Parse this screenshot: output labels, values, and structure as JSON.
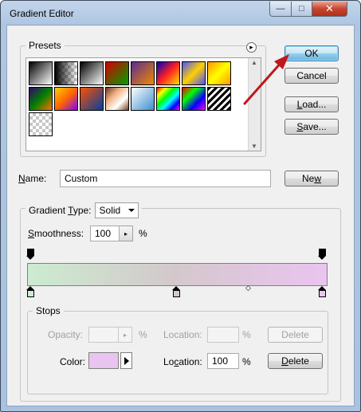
{
  "window": {
    "title": "Gradient Editor",
    "min_glyph": "—",
    "max_glyph": "□",
    "close_glyph": "✕"
  },
  "presets": {
    "label": "Presets",
    "menu_glyph": "▸",
    "scroll_up": "▲",
    "scroll_down": "▼",
    "swatches": [
      [
        "#000000",
        "#ffffff"
      ],
      [
        "#000000",
        "transparent"
      ],
      [
        "#000000",
        "#ffffff"
      ],
      [
        "#d40000",
        "#00a000"
      ],
      [
        "#5a2d91",
        "#f08a00"
      ],
      [
        "#0000c0",
        "#ff2020",
        "#ffe000"
      ],
      [
        "#5050ff",
        "#ffd000",
        "#5050ff"
      ],
      [
        "#ff9900",
        "#ffff00",
        "#ff9900"
      ],
      [
        "#3a0070",
        "#008000",
        "#ff7000"
      ],
      [
        "#ffcc00",
        "#ff6600",
        "#8000ff"
      ],
      [
        "#ff5000",
        "#0040a0"
      ],
      [
        "#6b3520",
        "#f0b080",
        "#ffffff",
        "#7b4020"
      ],
      [
        "#ffffff",
        "#3d8fd1"
      ],
      [
        "#ff0000",
        "#ffff00",
        "#00ff00",
        "#00ffff",
        "#0000ff",
        "#ff00ff"
      ],
      [
        "#ff0000",
        "#00ff00",
        "#0000ff",
        "#ff00ff"
      ],
      [
        "#000000",
        "#ffffff",
        "#000000",
        "#ffffff"
      ],
      [
        "transparent",
        "transparent"
      ]
    ]
  },
  "buttons": {
    "ok": "OK",
    "cancel": "Cancel",
    "load_u": "L",
    "load_rest": "oad...",
    "save_u": "S",
    "save_rest": "ave...",
    "new_pre": "Ne",
    "new_u": "w",
    "new_rest": ""
  },
  "name": {
    "label_u": "N",
    "label_rest": "ame:",
    "value": "Custom"
  },
  "gradient": {
    "type_pre": "Gradient ",
    "type_u": "T",
    "type_rest": "ype:",
    "type_value": "Solid",
    "smooth_u": "S",
    "smooth_rest": "moothness:",
    "smoothness": "100",
    "percent": "%",
    "start_color": "#ccecd0",
    "mid_color": "#d4c8cc",
    "end_color": "#eac4f0",
    "midpoint_glyph": "◇"
  },
  "stops": {
    "label": "Stops",
    "opacity_label": "Opacity:",
    "opacity_value": "",
    "location_label": "Location:",
    "location_value": "",
    "percent": "%",
    "delete_label": "Delete",
    "color_label": "Color:",
    "color_value": "#eac4f0",
    "color_location_pre": "Lo",
    "color_location_u": "c",
    "color_location_rest": "ation:",
    "color_location_value": "100",
    "delete2_u": "D",
    "delete2_rest": "elete"
  },
  "colors": {
    "arrow": "#c0161c"
  }
}
